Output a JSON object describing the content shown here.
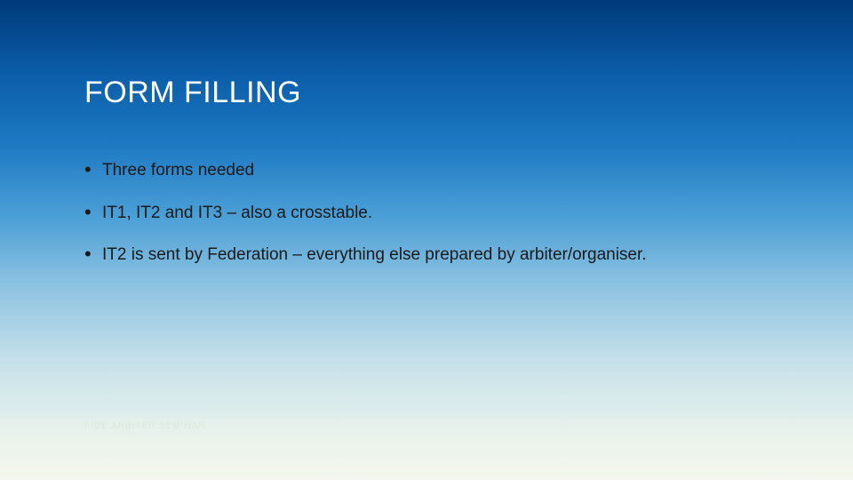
{
  "slide": {
    "title": "FORM FILLING",
    "bullets": [
      "Three forms needed",
      "IT1, IT2 and IT3 – also a crosstable.",
      "IT2 is sent by Federation – everything else prepared by arbiter/organiser."
    ],
    "footer": "FIDE ARBITER SEMINAR"
  }
}
